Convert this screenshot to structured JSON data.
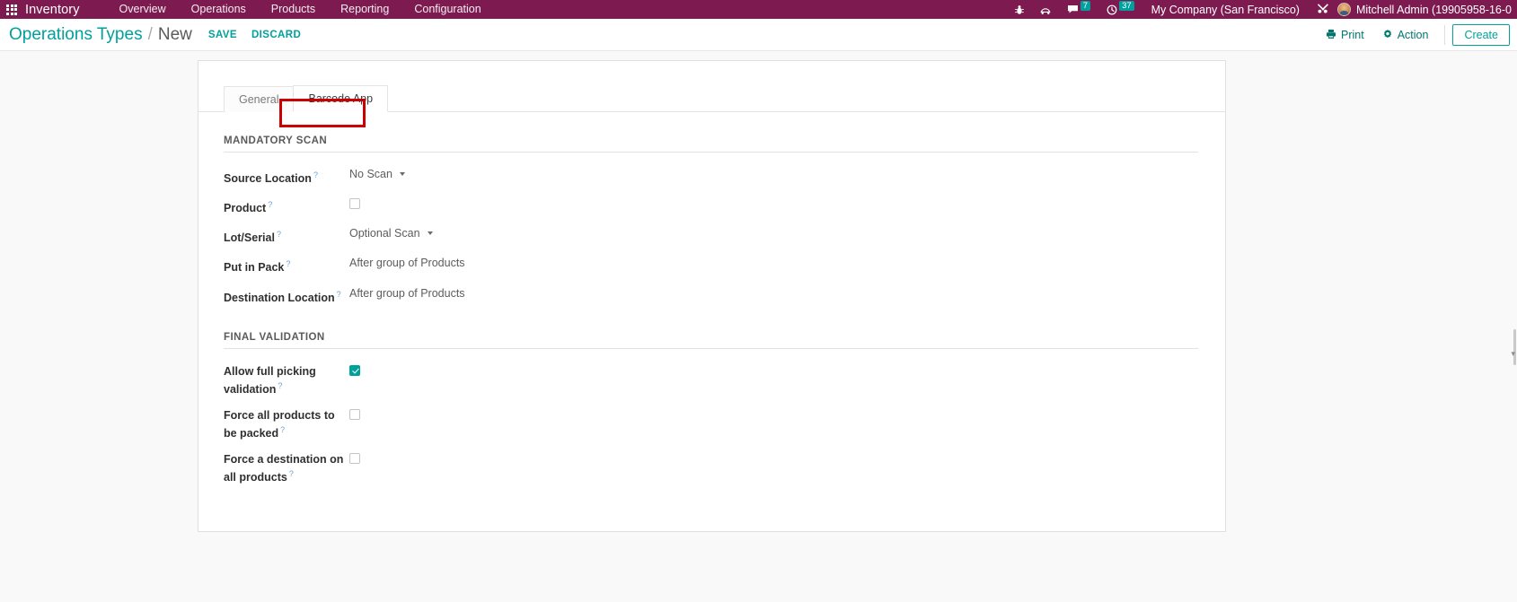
{
  "navbar": {
    "apps_icon": "grid-apps-icon",
    "brand": "Inventory",
    "menu": [
      {
        "label": "Overview"
      },
      {
        "label": "Operations"
      },
      {
        "label": "Products"
      },
      {
        "label": "Reporting"
      },
      {
        "label": "Configuration"
      }
    ],
    "right": {
      "bug_icon": "bug-icon",
      "support_icon": "lifebuoy-icon",
      "messages_icon": "chat-icon",
      "messages_count": "7",
      "activities_icon": "clock-icon",
      "activities_count": "37",
      "company": "My Company (San Francisco)",
      "tools_icon": "tools-icon",
      "avatar": "user-avatar",
      "user": "Mitchell Admin (19905958-16-0"
    }
  },
  "control_panel": {
    "breadcrumb_parent": "Operations Types",
    "breadcrumb_separator": "/",
    "breadcrumb_current": "New",
    "save_label": "SAVE",
    "discard_label": "DISCARD",
    "print_label": "Print",
    "print_icon": "printer-icon",
    "action_label": "Action",
    "action_icon": "gear-icon",
    "create_label": "Create"
  },
  "form": {
    "tabs": [
      {
        "label": "General",
        "active": false
      },
      {
        "label": "Barcode App",
        "active": true
      }
    ],
    "highlight_color": "#cc0000",
    "accent_color": "#00a09d",
    "brand_color": "#7d1b51",
    "groups": [
      {
        "title": "MANDATORY SCAN",
        "fields": [
          {
            "label": "Source Location",
            "help": "?",
            "type": "select",
            "value": "No Scan"
          },
          {
            "label": "Product",
            "help": "?",
            "type": "checkbox",
            "checked": false
          },
          {
            "label": "Lot/Serial",
            "help": "?",
            "type": "select",
            "value": "Optional Scan"
          },
          {
            "label": "Put in Pack",
            "help": "?",
            "type": "text",
            "value": "After group of Products"
          },
          {
            "label": "Destination Location",
            "help": "?",
            "type": "text",
            "value": "After group of Products"
          }
        ]
      },
      {
        "title": "FINAL VALIDATION",
        "fields": [
          {
            "label": "Allow full picking validation",
            "help": "?",
            "type": "checkbox",
            "checked": true
          },
          {
            "label": "Force all products to be packed",
            "help": "?",
            "type": "checkbox",
            "checked": false
          },
          {
            "label": "Force a destination on all products",
            "help": "?",
            "type": "checkbox",
            "checked": false
          }
        ]
      }
    ]
  }
}
